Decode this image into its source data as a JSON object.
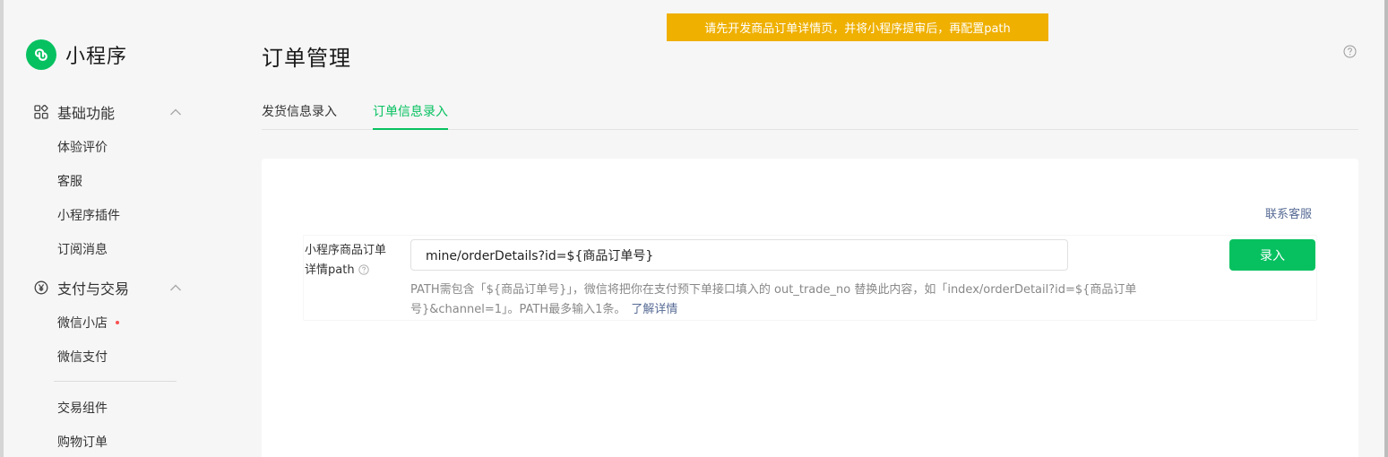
{
  "banner": "请先开发商品订单详情页，并将小程序提审后，再配置path",
  "sidebar": {
    "logo_text": "小程序",
    "groups": [
      {
        "label": "基础功能",
        "icon": "grid-icon",
        "expanded": true
      },
      {
        "label": "支付与交易",
        "icon": "yen-icon",
        "expanded": true
      }
    ],
    "items": [
      {
        "label": "体验评价"
      },
      {
        "label": "客服"
      },
      {
        "label": "小程序插件"
      },
      {
        "label": "订阅消息"
      },
      {
        "label": "微信小店",
        "badge": "red-dot"
      },
      {
        "label": "微信支付"
      },
      {
        "label": "交易组件"
      },
      {
        "label": "购物订单"
      }
    ]
  },
  "header": {
    "title": "订单管理"
  },
  "tabs": [
    {
      "label": "发货信息录入",
      "active": false
    },
    {
      "label": "订单信息录入",
      "active": true
    }
  ],
  "form": {
    "contact_link": "联系客服",
    "label_line1": "小程序商品订单",
    "label_line2": "详情path",
    "input_value": "mine/orderDetails?id=${商品订单号}",
    "submit_label": "录入",
    "hint_text": "PATH需包含「${商品订单号}」，微信将把你在支付预下单接口填入的 out_trade_no 替换此内容，如「index/orderDetail?id=${商品订单号}&channel=1」。PATH最多输入1条。",
    "learn_more": "了解详情"
  },
  "colors": {
    "accent": "#07c160",
    "banner": "#efb000",
    "link": "#576b95"
  }
}
